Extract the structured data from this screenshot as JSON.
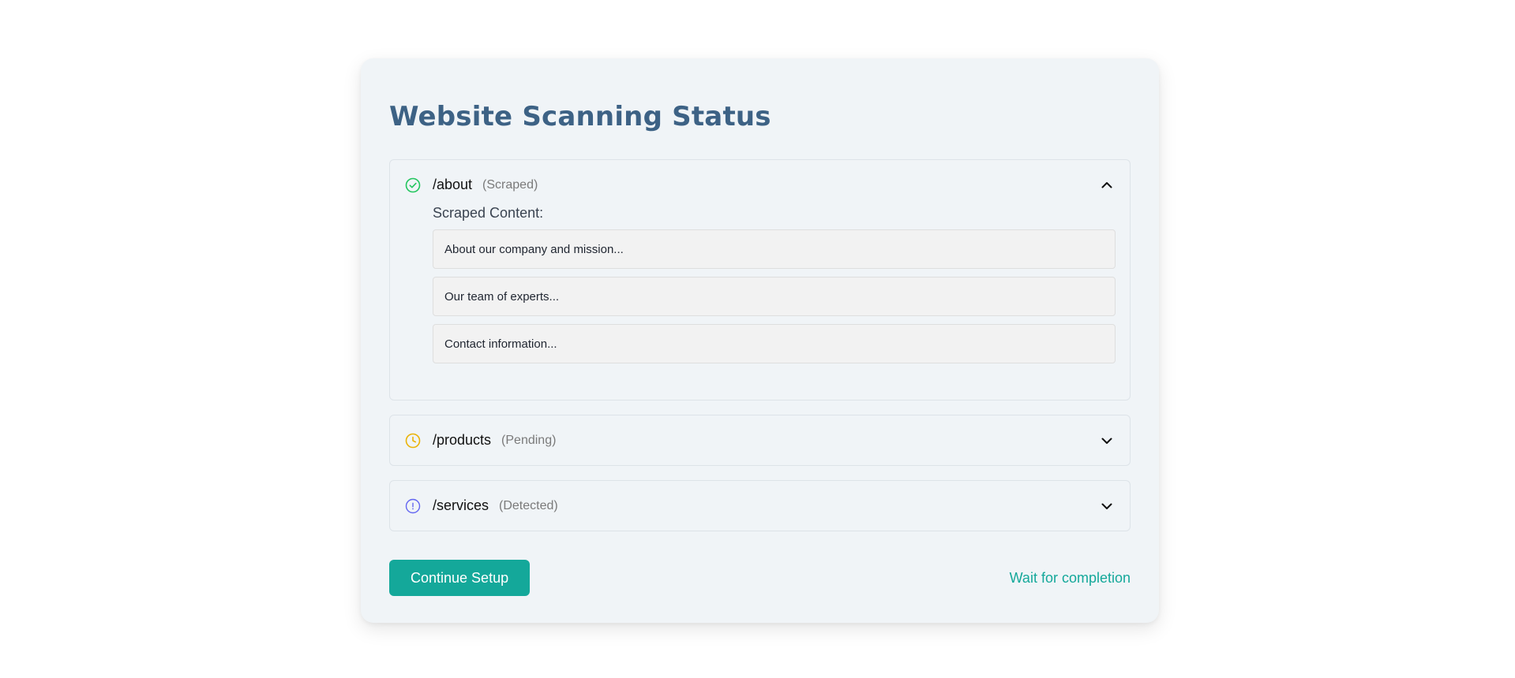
{
  "page": {
    "title": "Website Scanning Status"
  },
  "pages": [
    {
      "path": "/about",
      "status": "(Scraped)",
      "icon": "check-circle-icon",
      "icon_color": "#22c55e",
      "expanded": true,
      "content_title": "Scraped Content:",
      "snippets": [
        "About our company and mission...",
        "Our team of experts...",
        "Contact information..."
      ]
    },
    {
      "path": "/products",
      "status": "(Pending)",
      "icon": "clock-icon",
      "icon_color": "#eab308",
      "expanded": false
    },
    {
      "path": "/services",
      "status": "(Detected)",
      "icon": "info-circle-icon",
      "icon_color": "#6366f1",
      "expanded": false
    }
  ],
  "footer": {
    "continue_label": "Continue Setup",
    "wait_label": "Wait for completion"
  },
  "colors": {
    "accent": "#14a89a",
    "title": "#3d6285"
  }
}
